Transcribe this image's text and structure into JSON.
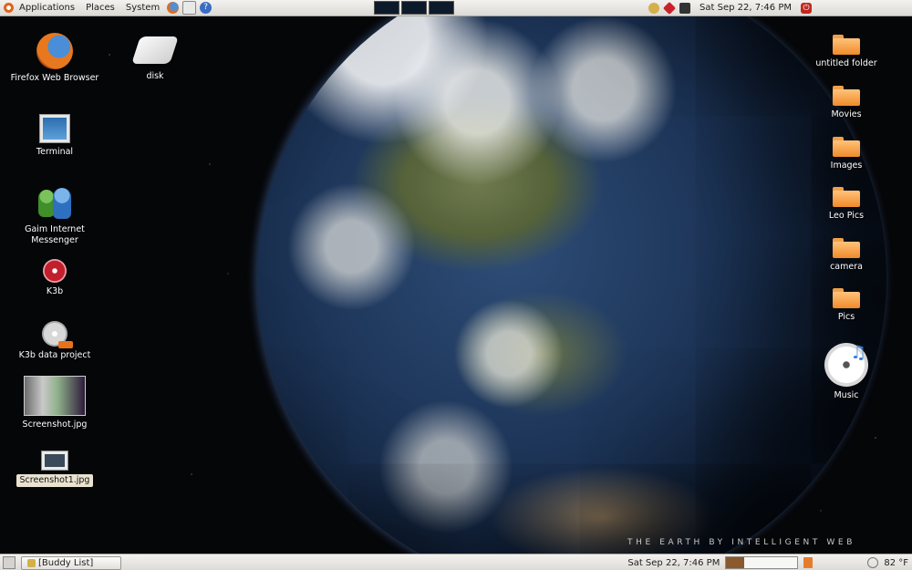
{
  "top_panel": {
    "menus": [
      "Applications",
      "Places",
      "System"
    ],
    "clock": "Sat Sep 22,  7:46 PM"
  },
  "bottom_panel": {
    "task_button": "[Buddy List]",
    "clock": "Sat Sep 22,  7:46 PM",
    "progress_fraction": 0.25,
    "weather": "82 °F"
  },
  "desktop_left": [
    {
      "label": "Firefox Web Browser"
    },
    {
      "label": "disk"
    },
    {
      "label": "Terminal"
    },
    {
      "label": "Gaim Internet Messenger"
    },
    {
      "label": "K3b"
    },
    {
      "label": "K3b data project"
    },
    {
      "label": "Screenshot.jpg"
    },
    {
      "label": "Screenshot1.jpg"
    }
  ],
  "desktop_right": [
    {
      "label": "untitled folder"
    },
    {
      "label": "Movies"
    },
    {
      "label": "Images"
    },
    {
      "label": "Leo Pics"
    },
    {
      "label": "camera"
    },
    {
      "label": "Pics"
    },
    {
      "label": "Music"
    }
  ],
  "wallpaper": {
    "credit": "THE EARTH BY INTELLIGENT WEB"
  }
}
